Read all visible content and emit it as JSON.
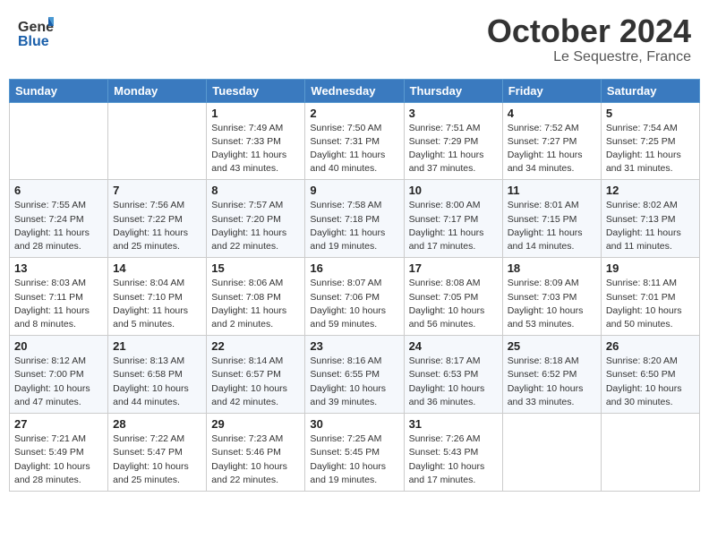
{
  "header": {
    "logo_general": "General",
    "logo_blue": "Blue",
    "month_title": "October 2024",
    "location": "Le Sequestre, France"
  },
  "weekdays": [
    "Sunday",
    "Monday",
    "Tuesday",
    "Wednesday",
    "Thursday",
    "Friday",
    "Saturday"
  ],
  "weeks": [
    [
      {
        "day": null,
        "info": null
      },
      {
        "day": null,
        "info": null
      },
      {
        "day": "1",
        "sunrise": "Sunrise: 7:49 AM",
        "sunset": "Sunset: 7:33 PM",
        "daylight": "Daylight: 11 hours and 43 minutes."
      },
      {
        "day": "2",
        "sunrise": "Sunrise: 7:50 AM",
        "sunset": "Sunset: 7:31 PM",
        "daylight": "Daylight: 11 hours and 40 minutes."
      },
      {
        "day": "3",
        "sunrise": "Sunrise: 7:51 AM",
        "sunset": "Sunset: 7:29 PM",
        "daylight": "Daylight: 11 hours and 37 minutes."
      },
      {
        "day": "4",
        "sunrise": "Sunrise: 7:52 AM",
        "sunset": "Sunset: 7:27 PM",
        "daylight": "Daylight: 11 hours and 34 minutes."
      },
      {
        "day": "5",
        "sunrise": "Sunrise: 7:54 AM",
        "sunset": "Sunset: 7:25 PM",
        "daylight": "Daylight: 11 hours and 31 minutes."
      }
    ],
    [
      {
        "day": "6",
        "sunrise": "Sunrise: 7:55 AM",
        "sunset": "Sunset: 7:24 PM",
        "daylight": "Daylight: 11 hours and 28 minutes."
      },
      {
        "day": "7",
        "sunrise": "Sunrise: 7:56 AM",
        "sunset": "Sunset: 7:22 PM",
        "daylight": "Daylight: 11 hours and 25 minutes."
      },
      {
        "day": "8",
        "sunrise": "Sunrise: 7:57 AM",
        "sunset": "Sunset: 7:20 PM",
        "daylight": "Daylight: 11 hours and 22 minutes."
      },
      {
        "day": "9",
        "sunrise": "Sunrise: 7:58 AM",
        "sunset": "Sunset: 7:18 PM",
        "daylight": "Daylight: 11 hours and 19 minutes."
      },
      {
        "day": "10",
        "sunrise": "Sunrise: 8:00 AM",
        "sunset": "Sunset: 7:17 PM",
        "daylight": "Daylight: 11 hours and 17 minutes."
      },
      {
        "day": "11",
        "sunrise": "Sunrise: 8:01 AM",
        "sunset": "Sunset: 7:15 PM",
        "daylight": "Daylight: 11 hours and 14 minutes."
      },
      {
        "day": "12",
        "sunrise": "Sunrise: 8:02 AM",
        "sunset": "Sunset: 7:13 PM",
        "daylight": "Daylight: 11 hours and 11 minutes."
      }
    ],
    [
      {
        "day": "13",
        "sunrise": "Sunrise: 8:03 AM",
        "sunset": "Sunset: 7:11 PM",
        "daylight": "Daylight: 11 hours and 8 minutes."
      },
      {
        "day": "14",
        "sunrise": "Sunrise: 8:04 AM",
        "sunset": "Sunset: 7:10 PM",
        "daylight": "Daylight: 11 hours and 5 minutes."
      },
      {
        "day": "15",
        "sunrise": "Sunrise: 8:06 AM",
        "sunset": "Sunset: 7:08 PM",
        "daylight": "Daylight: 11 hours and 2 minutes."
      },
      {
        "day": "16",
        "sunrise": "Sunrise: 8:07 AM",
        "sunset": "Sunset: 7:06 PM",
        "daylight": "Daylight: 10 hours and 59 minutes."
      },
      {
        "day": "17",
        "sunrise": "Sunrise: 8:08 AM",
        "sunset": "Sunset: 7:05 PM",
        "daylight": "Daylight: 10 hours and 56 minutes."
      },
      {
        "day": "18",
        "sunrise": "Sunrise: 8:09 AM",
        "sunset": "Sunset: 7:03 PM",
        "daylight": "Daylight: 10 hours and 53 minutes."
      },
      {
        "day": "19",
        "sunrise": "Sunrise: 8:11 AM",
        "sunset": "Sunset: 7:01 PM",
        "daylight": "Daylight: 10 hours and 50 minutes."
      }
    ],
    [
      {
        "day": "20",
        "sunrise": "Sunrise: 8:12 AM",
        "sunset": "Sunset: 7:00 PM",
        "daylight": "Daylight: 10 hours and 47 minutes."
      },
      {
        "day": "21",
        "sunrise": "Sunrise: 8:13 AM",
        "sunset": "Sunset: 6:58 PM",
        "daylight": "Daylight: 10 hours and 44 minutes."
      },
      {
        "day": "22",
        "sunrise": "Sunrise: 8:14 AM",
        "sunset": "Sunset: 6:57 PM",
        "daylight": "Daylight: 10 hours and 42 minutes."
      },
      {
        "day": "23",
        "sunrise": "Sunrise: 8:16 AM",
        "sunset": "Sunset: 6:55 PM",
        "daylight": "Daylight: 10 hours and 39 minutes."
      },
      {
        "day": "24",
        "sunrise": "Sunrise: 8:17 AM",
        "sunset": "Sunset: 6:53 PM",
        "daylight": "Daylight: 10 hours and 36 minutes."
      },
      {
        "day": "25",
        "sunrise": "Sunrise: 8:18 AM",
        "sunset": "Sunset: 6:52 PM",
        "daylight": "Daylight: 10 hours and 33 minutes."
      },
      {
        "day": "26",
        "sunrise": "Sunrise: 8:20 AM",
        "sunset": "Sunset: 6:50 PM",
        "daylight": "Daylight: 10 hours and 30 minutes."
      }
    ],
    [
      {
        "day": "27",
        "sunrise": "Sunrise: 7:21 AM",
        "sunset": "Sunset: 5:49 PM",
        "daylight": "Daylight: 10 hours and 28 minutes."
      },
      {
        "day": "28",
        "sunrise": "Sunrise: 7:22 AM",
        "sunset": "Sunset: 5:47 PM",
        "daylight": "Daylight: 10 hours and 25 minutes."
      },
      {
        "day": "29",
        "sunrise": "Sunrise: 7:23 AM",
        "sunset": "Sunset: 5:46 PM",
        "daylight": "Daylight: 10 hours and 22 minutes."
      },
      {
        "day": "30",
        "sunrise": "Sunrise: 7:25 AM",
        "sunset": "Sunset: 5:45 PM",
        "daylight": "Daylight: 10 hours and 19 minutes."
      },
      {
        "day": "31",
        "sunrise": "Sunrise: 7:26 AM",
        "sunset": "Sunset: 5:43 PM",
        "daylight": "Daylight: 10 hours and 17 minutes."
      },
      {
        "day": null,
        "info": null
      },
      {
        "day": null,
        "info": null
      }
    ]
  ]
}
